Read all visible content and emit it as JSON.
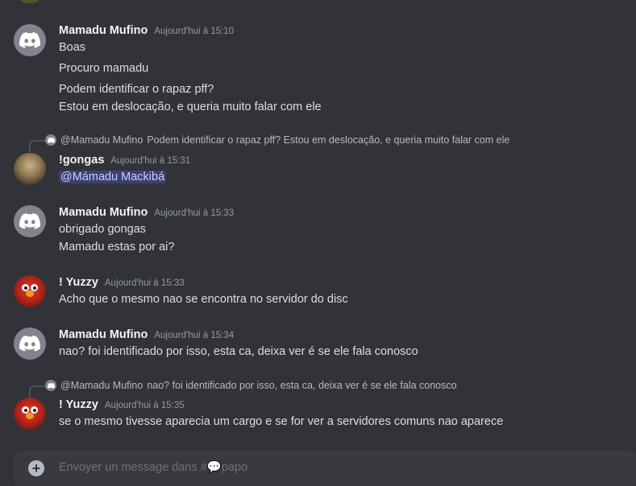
{
  "composer": {
    "placeholder_prefix": "Envoyer un message dans #",
    "channel_emoji": "💬",
    "channel_name": "papo"
  },
  "messages": [
    {
      "author": "Mamadu Mufino",
      "timestamp": "Aujourd'hui à 15:10",
      "lines": [
        "Boas",
        "Procuro mamadu",
        "Podem identificar o rapaz pff?",
        "Estou em deslocação, e queria muito falar com ele"
      ]
    },
    {
      "reply_to": {
        "author": "@Mamadu Mufino",
        "text": "Podem identificar o rapaz pff? Estou em deslocação, e queria muito falar com ele"
      },
      "author": "!gongas",
      "timestamp": "Aujourd'hui à 15:31",
      "mention": "@Mámadu Mackibá"
    },
    {
      "author": "Mamadu Mufino",
      "timestamp": "Aujourd'hui à 15:33",
      "lines": [
        "obrigado gongas",
        "Mamadu estas por ai?"
      ]
    },
    {
      "author": "! Yuzzy",
      "timestamp": "Aujourd'hui à 15:33",
      "lines": [
        "Acho que o mesmo nao se encontra no servidor do disc"
      ]
    },
    {
      "author": "Mamadu Mufino",
      "timestamp": "Aujourd'hui à 15:34",
      "lines": [
        "nao? foi identificado por isso, esta ca, deixa ver é se ele fala conosco"
      ]
    },
    {
      "reply_to": {
        "author": "@Mamadu Mufino",
        "text": "nao? foi identificado por isso, esta ca, deixa ver é se ele fala conosco"
      },
      "author": "! Yuzzy",
      "timestamp": "Aujourd'hui à 15:35",
      "lines": [
        "se o mesmo tivesse aparecia um cargo e se for ver a servidores comuns nao aparece"
      ]
    }
  ]
}
